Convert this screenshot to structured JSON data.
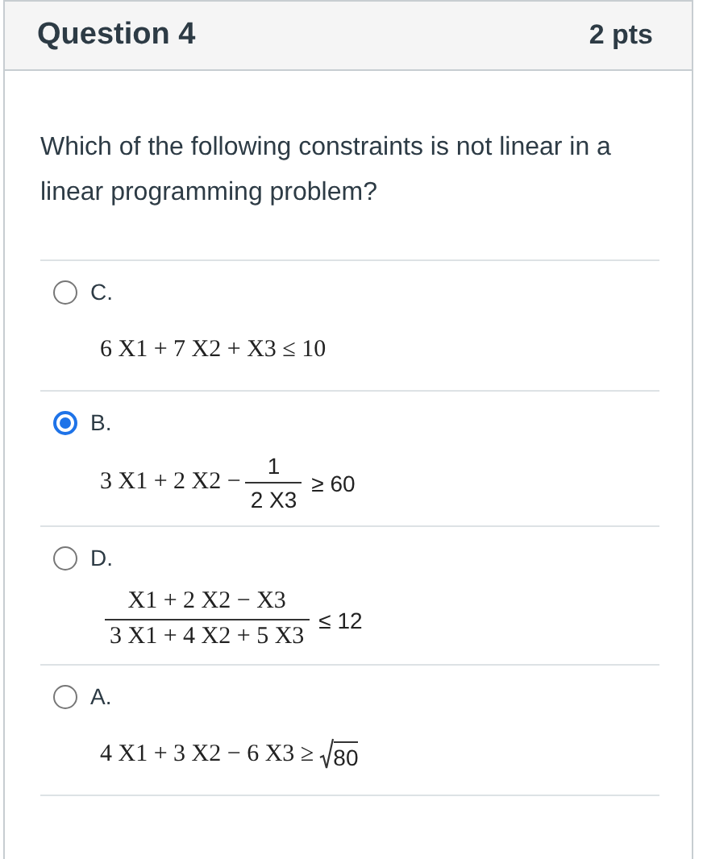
{
  "question": {
    "title": "Question 4",
    "points": "2 pts",
    "text": "Which of the following constraints is not linear in a linear programming problem?"
  },
  "options": [
    {
      "label": "C.",
      "selected": false,
      "formula": {
        "kind": "plain",
        "lead": "6 X1 + 7 X2 + X3 ≤ 10"
      }
    },
    {
      "label": "B.",
      "selected": true,
      "formula": {
        "kind": "term_fraction",
        "lead": "3 X1 + 2 X2 −",
        "numerator": "1",
        "denominator": "2 X3",
        "tail": "≥ 60"
      }
    },
    {
      "label": "D.",
      "selected": false,
      "formula": {
        "kind": "fraction",
        "numerator": "X1 + 2 X2 − X3",
        "denominator": "3 X1 + 4 X2 + 5 X3",
        "tail": "≤ 12"
      }
    },
    {
      "label": "A.",
      "selected": false,
      "formula": {
        "kind": "sqrt",
        "lead": "4 X1 + 3 X2 − 6 X3 ≥",
        "radicand": "80"
      }
    }
  ]
}
